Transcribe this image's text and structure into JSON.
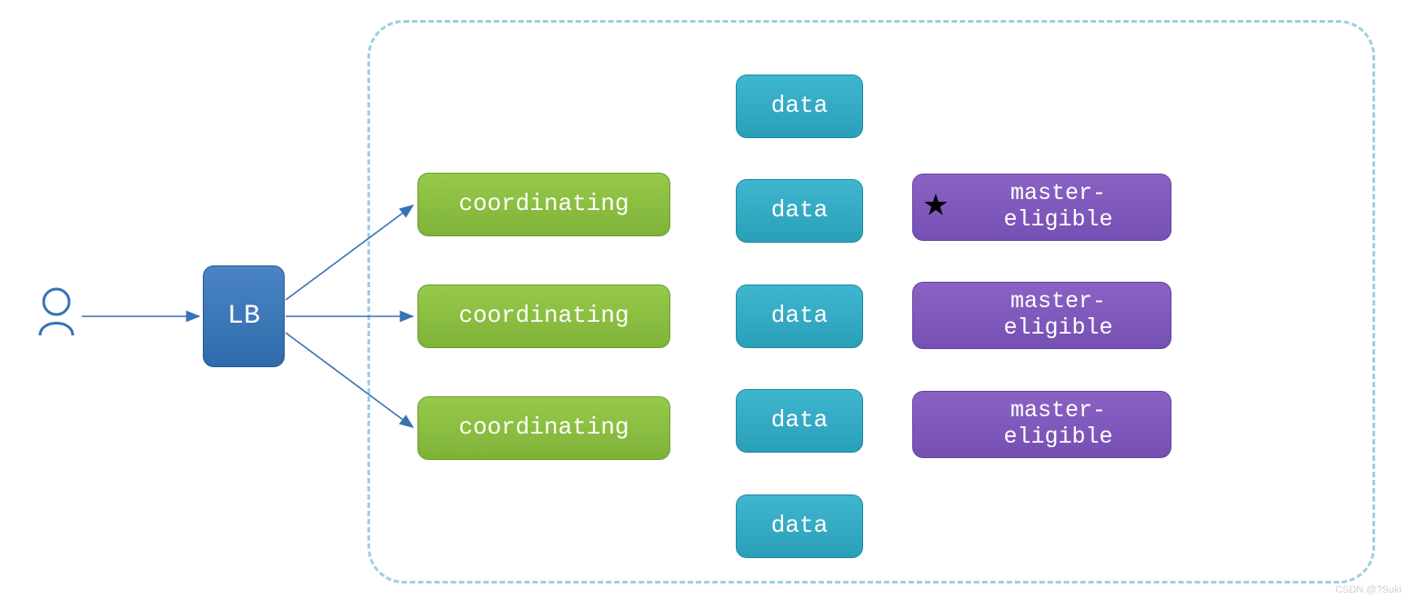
{
  "user": {
    "icon_name": "user-icon"
  },
  "lb": {
    "label": "LB"
  },
  "coordinating": [
    {
      "label": "coordinating"
    },
    {
      "label": "coordinating"
    },
    {
      "label": "coordinating"
    }
  ],
  "data_nodes": [
    {
      "label": "data"
    },
    {
      "label": "data"
    },
    {
      "label": "data"
    },
    {
      "label": "data"
    },
    {
      "label": "data"
    }
  ],
  "master_eligible": [
    {
      "label": "master-\neligible",
      "starred": true
    },
    {
      "label": "master-\neligible",
      "starred": false
    },
    {
      "label": "master-\neligible",
      "starred": false
    }
  ],
  "colors": {
    "lb": "#3773b5",
    "coord": "#8bc240",
    "data": "#34adc6",
    "master": "#7f57bb",
    "cluster_border": "#9fd0e1",
    "arrow": "#3773b5"
  },
  "watermark": "CSDN @?Suki"
}
